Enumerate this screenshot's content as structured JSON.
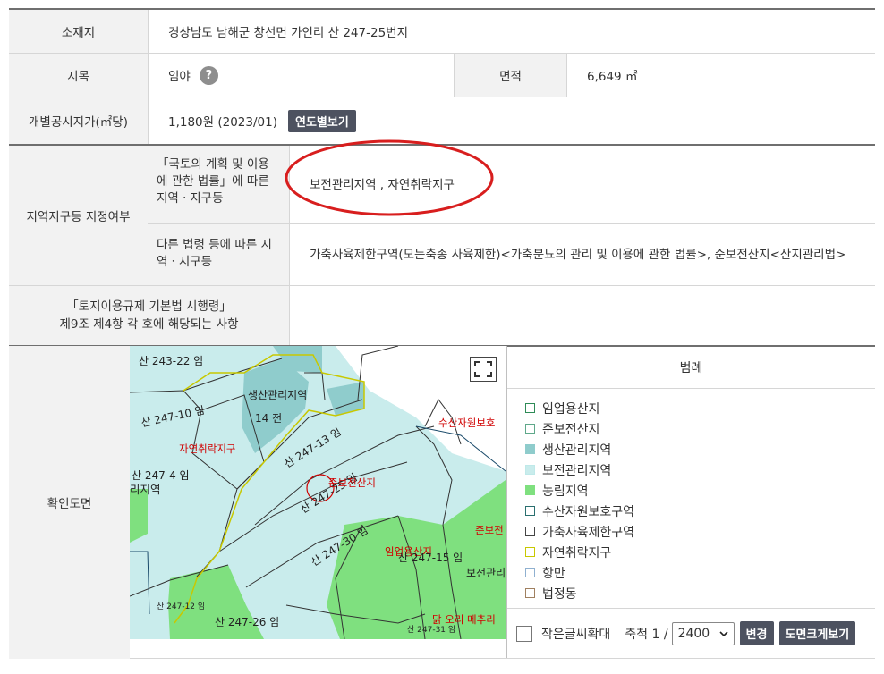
{
  "rows": {
    "location": {
      "label": "소재지",
      "value": "경상남도 남해군 창선면 가인리 산 247-25번지"
    },
    "land_category": {
      "label": "지목",
      "value": "임야",
      "help_icon": "?"
    },
    "area": {
      "label": "면적",
      "value": "6,649 ㎡"
    },
    "official_price": {
      "label": "개별공시지가(㎡당)",
      "value": "1,180원 (2023/01)",
      "button": "연도별보기"
    },
    "zoning": {
      "label": "지역지구등 지정여부",
      "national_law_label": "「국토의 계획 및 이용 에 관한 법률」에 따른 지역ㆍ지구등",
      "national_law_value": "보전관리지역 , 자연취락지구",
      "other_law_label": "다른 법령 등에 따른 지역ㆍ지구등",
      "other_law_value": "가축사육제한구역(모든축종 사육제한)<가축분뇨의 관리 및 이용에 관한 법률>, 준보전산지<산지관리법>"
    },
    "enforcement": {
      "label_line1": "「토지이용규제 기본법 시행령」",
      "label_line2": "제9조 제4항 각 호에 해당되는 사항",
      "value": ""
    },
    "map": {
      "label": "확인도면"
    }
  },
  "map_labels": {
    "l1": "산 243-22 임",
    "l2": "생산관리지역",
    "l3": "14 전",
    "l4": "산 247-10 임",
    "l5": "자연취락지구",
    "l6": "산 247-13 임",
    "l7": "수산자원보호",
    "l8": "산 247-4 임",
    "l9": "리지역",
    "l10": "산 247-25 임",
    "l11": "준보전산지",
    "l12": "산 247-30 임",
    "l13": "준보전",
    "l14": "임업용산지",
    "l15": "산 247-15 임",
    "l16": "보전관리",
    "l17": "산 247-12 임",
    "l18": "산 247-26 임",
    "l19": "닭 오리 메추리",
    "l20": "산 247-31 임"
  },
  "legend": {
    "title": "범례",
    "items": [
      {
        "label": "임업용산지",
        "color": "#2e8b57",
        "fill": "#ffffff"
      },
      {
        "label": "준보전산지",
        "color": "#5fa88a",
        "fill": "#ffffff"
      },
      {
        "label": "생산관리지역",
        "color": "#8fcccc",
        "fill": "#8fcccc"
      },
      {
        "label": "보전관리지역",
        "color": "#bfe9e9",
        "fill": "#c9ecec"
      },
      {
        "label": "농림지역",
        "color": "#7fe07f",
        "fill": "#7fe07f"
      },
      {
        "label": "수산자원보호구역",
        "color": "#2a6f6f",
        "fill": "#ffffff"
      },
      {
        "label": "가축사육제한구역",
        "color": "#444444",
        "fill": "#ffffff"
      },
      {
        "label": "자연취락지구",
        "color": "#c8c800",
        "fill": "#ffffff"
      },
      {
        "label": "항만",
        "color": "#8fb0d0",
        "fill": "#ffffff"
      },
      {
        "label": "법정동",
        "color": "#a08060",
        "fill": "#ffffff"
      }
    ]
  },
  "controls": {
    "small_text_zoom": "작은글씨확대",
    "scale_label": "축척 1 /",
    "scale_value": "2400",
    "change_button": "변경",
    "view_large_button": "도면크게보기"
  },
  "colors": {
    "header_bg": "#f2f2f2",
    "button_dark": "#4d5260",
    "annotation_red": "#d81e1e"
  }
}
